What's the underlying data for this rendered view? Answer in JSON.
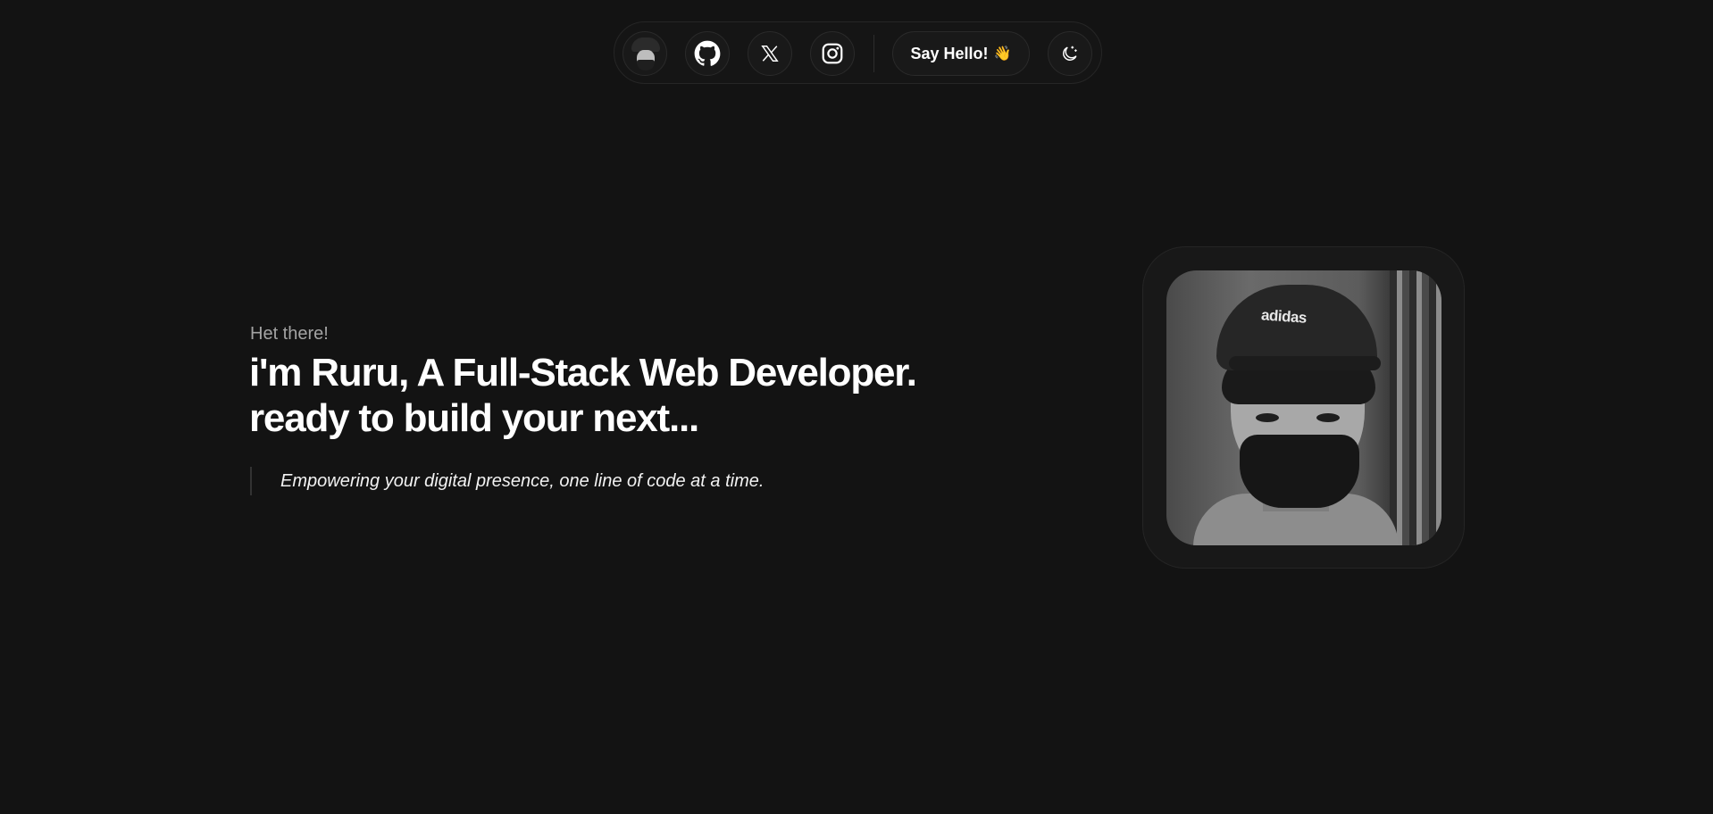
{
  "nav": {
    "avatar_alt": "profile avatar",
    "icons": [
      "github-icon",
      "x-icon",
      "instagram-icon",
      "moon-icon"
    ],
    "say_hello_label": "Say Hello!",
    "say_hello_emoji": "👋"
  },
  "hero": {
    "greeting": "Het there!",
    "headline_line1": "i'm Ruru, A Full-Stack Web Developer.",
    "headline_line2": "ready to build your next...",
    "tagline": "Empowering your digital presence, one line of code at a time."
  },
  "photo": {
    "cap_logo_text": "adidas"
  },
  "colors": {
    "background": "#131313",
    "text": "#ffffff",
    "muted": "#a3a3a3",
    "border": "#262626"
  }
}
